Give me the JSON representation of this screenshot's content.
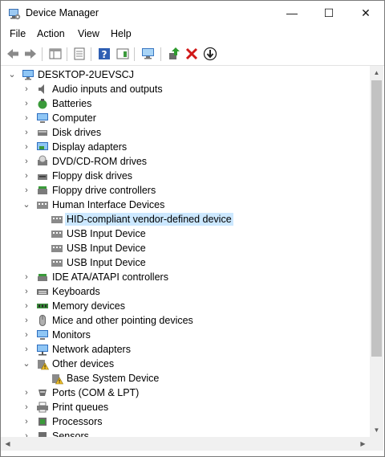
{
  "window": {
    "title": "Device Manager",
    "minimize": "—",
    "maximize": "☐",
    "close": "✕"
  },
  "menu": {
    "file": "File",
    "action": "Action",
    "view": "View",
    "help": "Help"
  },
  "tree": {
    "root": "DESKTOP-2UEVSCJ",
    "items": [
      "Audio inputs and outputs",
      "Batteries",
      "Computer",
      "Disk drives",
      "Display adapters",
      "DVD/CD-ROM drives",
      "Floppy disk drives",
      "Floppy drive controllers",
      "Human Interface Devices",
      "HID-compliant vendor-defined device",
      "USB Input Device",
      "USB Input Device",
      "USB Input Device",
      "IDE ATA/ATAPI controllers",
      "Keyboards",
      "Memory devices",
      "Mice and other pointing devices",
      "Monitors",
      "Network adapters",
      "Other devices",
      "Base System Device",
      "Ports (COM & LPT)",
      "Print queues",
      "Processors",
      "Sensors"
    ]
  },
  "colors": {
    "selection": "#cce8ff",
    "scroll_thumb": "#c2c2c2"
  }
}
